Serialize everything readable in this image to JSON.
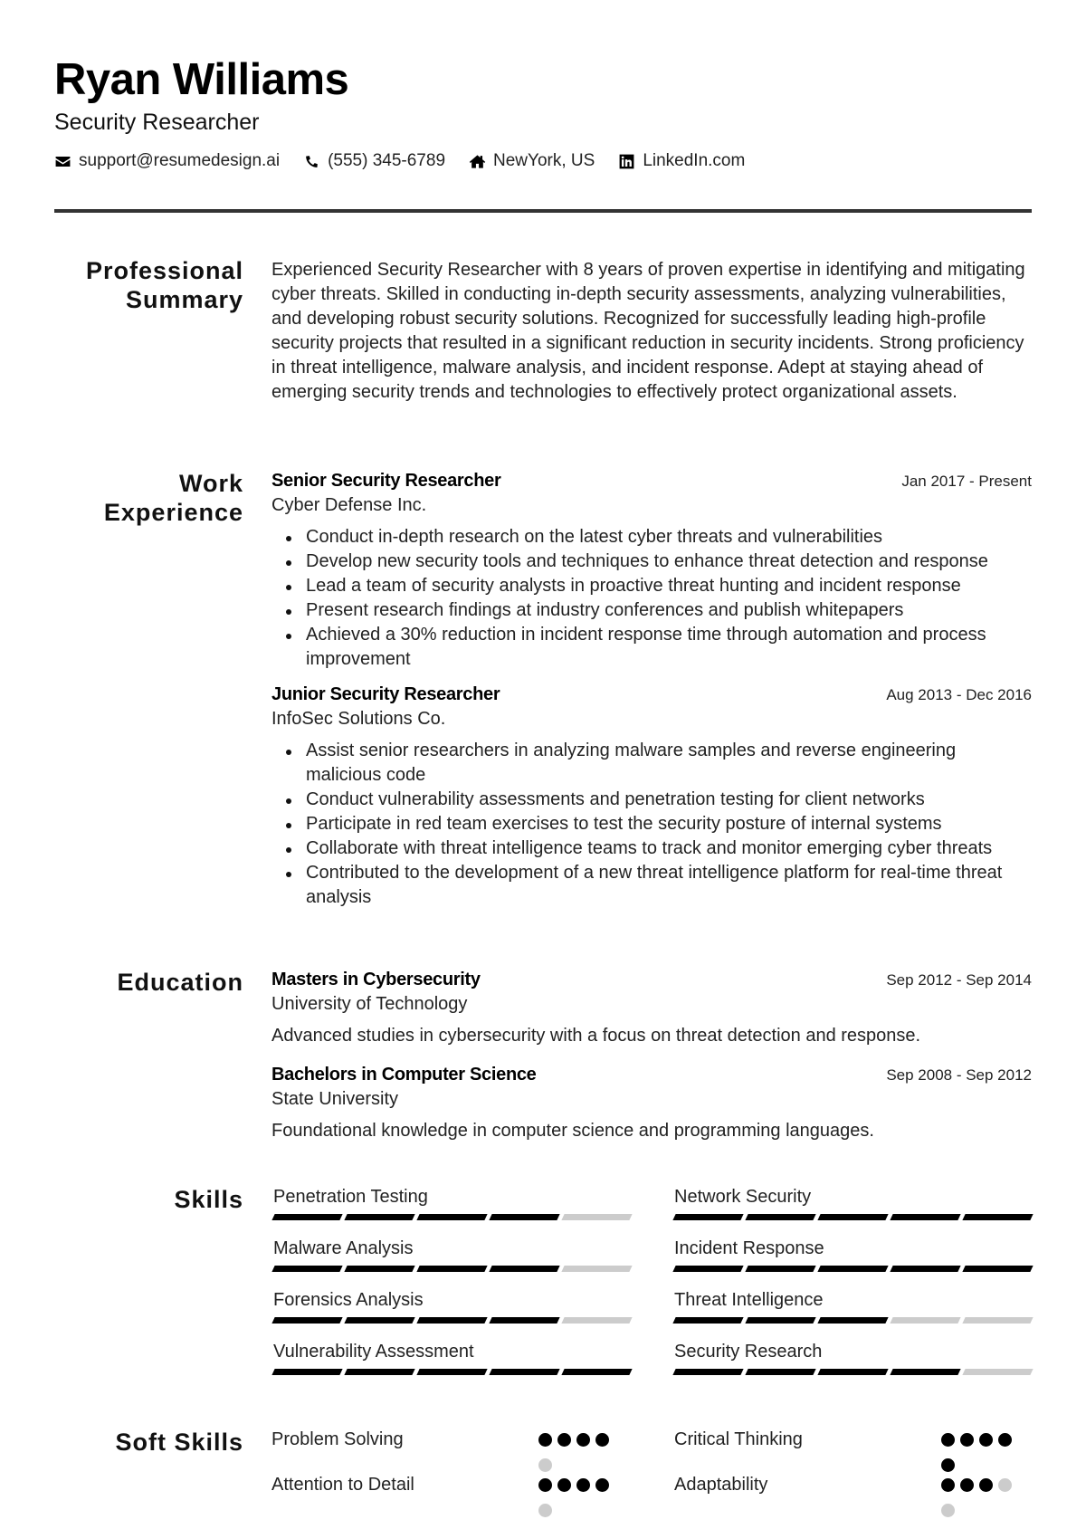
{
  "header": {
    "name": "Ryan Williams",
    "title": "Security Researcher",
    "contacts": [
      {
        "icon": "envelope-icon",
        "text": "support@resumedesign.ai"
      },
      {
        "icon": "phone-icon",
        "text": "(555) 345-6789"
      },
      {
        "icon": "home-icon",
        "text": "NewYork, US"
      },
      {
        "icon": "linkedin-icon",
        "text": "LinkedIn.com"
      }
    ]
  },
  "summary": {
    "heading_line1": "Professional",
    "heading_line2": "Summary",
    "text": "Experienced Security Researcher with 8 years of proven expertise in identifying and mitigating cyber threats. Skilled in conducting in-depth security assessments, analyzing vulnerabilities, and developing robust security solutions. Recognized for successfully leading high-profile security projects that resulted in a significant reduction in security incidents. Strong proficiency in threat intelligence, malware analysis, and incident response. Adept at staying ahead of emerging security trends and technologies to effectively protect organizational assets."
  },
  "experience": {
    "heading_line1": "Work",
    "heading_line2": "Experience",
    "jobs": [
      {
        "title": "Senior Security Researcher",
        "date": "Jan 2017 - Present",
        "company": "Cyber Defense Inc.",
        "bullets": [
          "Conduct in-depth research on the latest cyber threats and vulnerabilities",
          "Develop new security tools and techniques to enhance threat detection and response",
          "Lead a team of security analysts in proactive threat hunting and incident response",
          "Present research findings at industry conferences and publish whitepapers",
          "Achieved a 30% reduction in incident response time through automation and process improvement"
        ]
      },
      {
        "title": "Junior Security Researcher",
        "date": "Aug 2013 - Dec 2016",
        "company": "InfoSec Solutions Co.",
        "bullets": [
          "Assist senior researchers in analyzing malware samples and reverse engineering malicious code",
          "Conduct vulnerability assessments and penetration testing for client networks",
          "Participate in red team exercises to test the security posture of internal systems",
          "Collaborate with threat intelligence teams to track and monitor emerging cyber threats",
          "Contributed to the development of a new threat intelligence platform for real-time threat analysis"
        ]
      }
    ]
  },
  "education": {
    "heading": "Education",
    "items": [
      {
        "degree": "Masters in Cybersecurity",
        "date": "Sep 2012 - Sep 2014",
        "school": "University of Technology",
        "description": "Advanced studies in cybersecurity with a focus on threat detection and response."
      },
      {
        "degree": "Bachelors in Computer Science",
        "date": "Sep 2008 - Sep 2012",
        "school": "State University",
        "description": "Foundational knowledge in computer science and programming languages."
      }
    ]
  },
  "skills": {
    "heading": "Skills",
    "max_level": 5,
    "items": [
      {
        "name": "Penetration Testing",
        "level": 4
      },
      {
        "name": "Network Security",
        "level": 5
      },
      {
        "name": "Malware Analysis",
        "level": 4
      },
      {
        "name": "Incident Response",
        "level": 5
      },
      {
        "name": "Forensics Analysis",
        "level": 4
      },
      {
        "name": "Threat Intelligence",
        "level": 3
      },
      {
        "name": "Vulnerability Assessment",
        "level": 5
      },
      {
        "name": "Security Research",
        "level": 4
      }
    ]
  },
  "soft_skills": {
    "heading": "Soft Skills",
    "max_level": 5,
    "items": [
      {
        "name": "Problem Solving",
        "level": 4
      },
      {
        "name": "Critical Thinking",
        "level": 5
      },
      {
        "name": "Attention to Detail",
        "level": 4
      },
      {
        "name": "Adaptability",
        "level": 3
      }
    ]
  },
  "colors": {
    "filled": "#000000",
    "empty": "#cccccc",
    "rule": "#333333"
  }
}
